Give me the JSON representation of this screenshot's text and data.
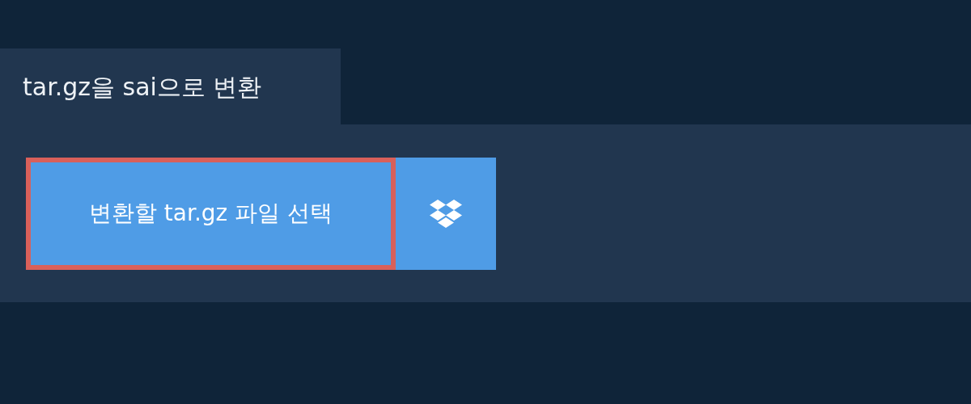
{
  "tab": {
    "label": "tar.gz을 sai으로 변환",
    "selected": true
  },
  "select_button": {
    "label": "변환할 tar.gz 파일 선택",
    "focused": true
  }
}
